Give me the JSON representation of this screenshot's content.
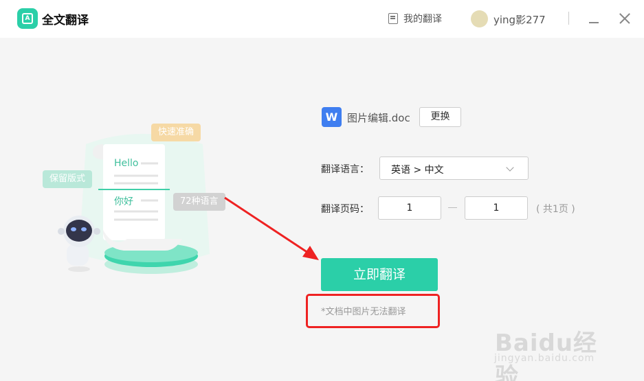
{
  "app": {
    "title": "全文翻译"
  },
  "header": {
    "my_translations": "我的翻译",
    "username": "ying影277"
  },
  "illustration": {
    "tags": [
      "快速准确",
      "保留版式",
      "72种语言"
    ],
    "hello": "Hello",
    "nihao": "你好"
  },
  "file": {
    "name": "图片编辑.doc",
    "icon_letter": "W",
    "change_label": "更换"
  },
  "language": {
    "label": "翻译语言：",
    "value": "英语 > 中文"
  },
  "pages": {
    "label": "翻译页码：",
    "from": "1",
    "to": "1",
    "total": "( 共1页 )"
  },
  "actions": {
    "translate_label": "立即翻译"
  },
  "note": "*文档中图片无法翻译",
  "watermark": {
    "main": "Baidu经验",
    "sub": "jingyan.baidu.com"
  },
  "colors": {
    "accent": "#2bcfa8",
    "highlight": "#ee2222"
  },
  "icons": {
    "logo": "translate-logo-icon",
    "my_translations": "document-icon",
    "minimize": "minimize-icon",
    "close": "close-icon"
  }
}
